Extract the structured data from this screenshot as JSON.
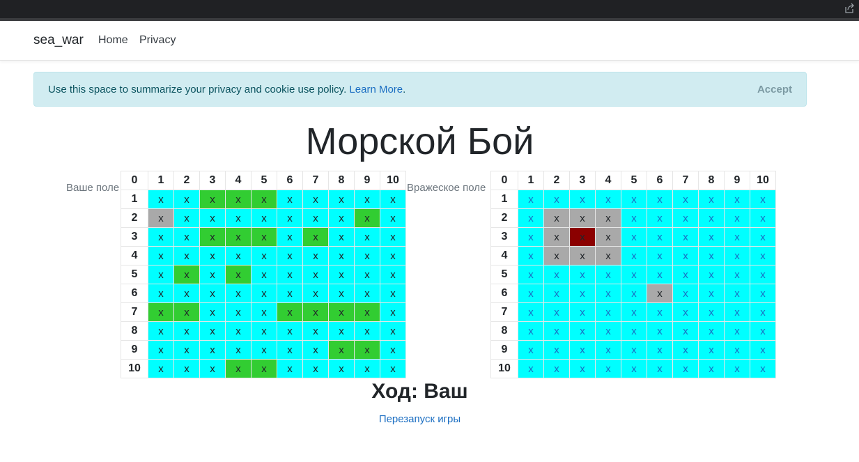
{
  "navbar": {
    "brand": "sea_war",
    "links": [
      "Home",
      "Privacy"
    ]
  },
  "cookie_alert": {
    "text": "Use this space to summarize your privacy and cookie use policy. ",
    "link": "Learn More",
    "period": ".",
    "accept": "Accept"
  },
  "title": "Морской Бой",
  "boards": {
    "yours": {
      "label": "Ваше поле",
      "corner": "0",
      "col_headers": [
        "1",
        "2",
        "3",
        "4",
        "5",
        "6",
        "7",
        "8",
        "9",
        "10"
      ],
      "row_headers": [
        "1",
        "2",
        "3",
        "4",
        "5",
        "6",
        "7",
        "8",
        "9",
        "10"
      ],
      "cell_text": "x",
      "rows": [
        "wwsssWwwww",
        "mwwwwwwwsw",
        "wwsssWswww",
        "wwwwwwwwww",
        "wswswwwwww",
        "wwwwwwwwww",
        "sswwwsssswW",
        "wwwwwwwwww",
        "wwwwwwwssw",
        "wwwsswwwww"
      ]
    },
    "enemy": {
      "label": "Вражеское поле",
      "corner": "0",
      "col_headers": [
        "1",
        "2",
        "3",
        "4",
        "5",
        "6",
        "7",
        "8",
        "9",
        "10"
      ],
      "row_headers": [
        "1",
        "2",
        "3",
        "4",
        "5",
        "6",
        "7",
        "8",
        "9",
        "10"
      ],
      "cell_text": "x",
      "rows": [
        "wwwwwwwwww",
        "wmmmwwwwww",
        "wmhmwwwwww",
        "wmmmwwwwww",
        "wwwwwwwwww",
        "wwwwwmwwww",
        "wwwwwwwwww",
        "wwwwwwwwww",
        "wwwwwwwwww",
        "wwwwwwwwww"
      ]
    }
  },
  "cell_states": {
    "w": "#00ffff",
    "s": "#32cd32",
    "m": "#a9a9a9",
    "h": "#8b0000"
  },
  "turn": "Ход: Ваш",
  "restart": "Перезапуск игры",
  "icons": {
    "share": "share-icon"
  }
}
